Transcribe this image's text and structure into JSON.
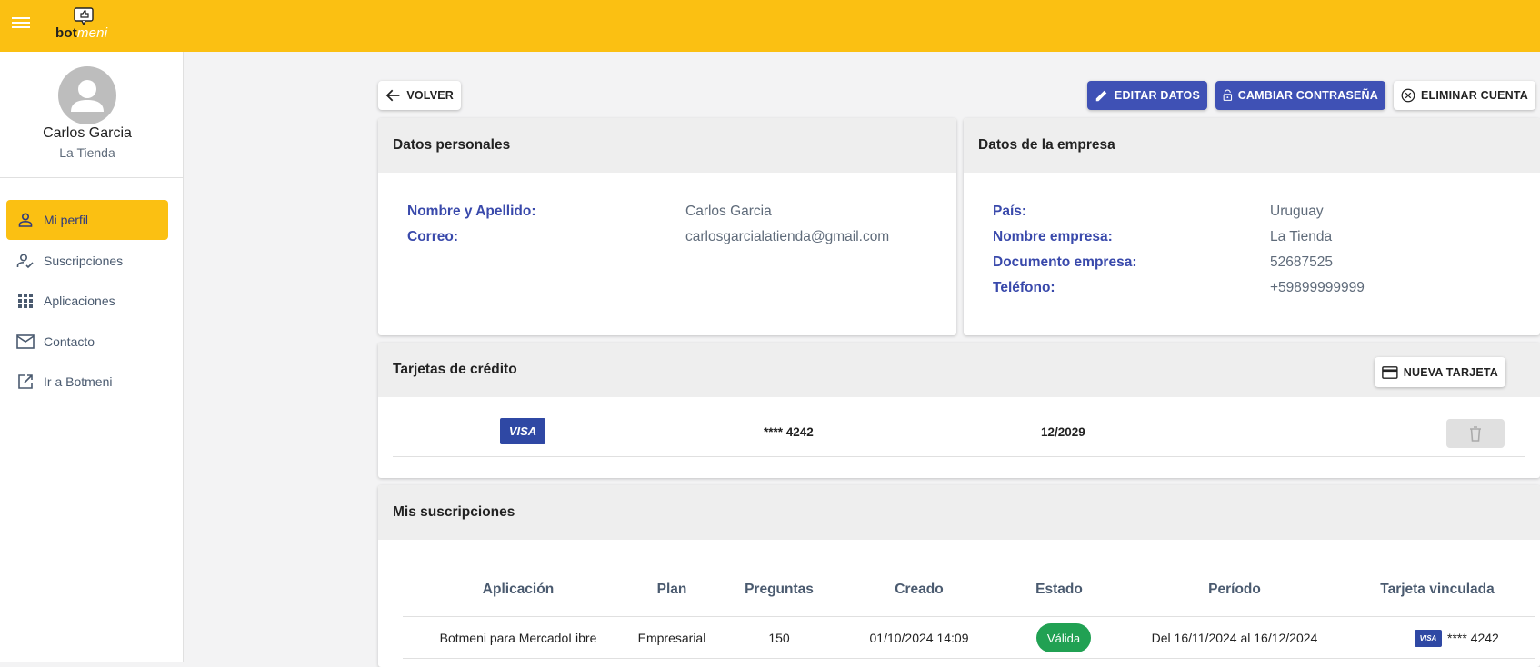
{
  "brand": {
    "word_bot": "bot",
    "word_meni": "meni"
  },
  "user": {
    "name": "Carlos Garcia",
    "company": "La Tienda"
  },
  "nav": {
    "items": [
      {
        "label": "Mi perfil",
        "icon": "person-icon",
        "active": true
      },
      {
        "label": "Suscripciones",
        "icon": "person-check-icon",
        "active": false
      },
      {
        "label": "Aplicaciones",
        "icon": "apps-grid-icon",
        "active": false
      },
      {
        "label": "Contacto",
        "icon": "mail-icon",
        "active": false
      },
      {
        "label": "Ir a Botmeni",
        "icon": "open-external-icon",
        "active": false
      }
    ]
  },
  "actions": {
    "back": "VOLVER",
    "edit": "EDITAR DATOS",
    "change_password": "CAMBIAR CONTRASEÑA",
    "delete_account": "ELIMINAR CUENTA"
  },
  "personal": {
    "title": "Datos personales",
    "fields": [
      {
        "key": "Nombre y Apellido:",
        "value": "Carlos Garcia"
      },
      {
        "key": "Correo:",
        "value": "carlosgarcialatienda@gmail.com"
      }
    ]
  },
  "company": {
    "title": "Datos de la empresa",
    "fields": [
      {
        "key": "País:",
        "value": "Uruguay"
      },
      {
        "key": "Nombre empresa:",
        "value": "La Tienda"
      },
      {
        "key": "Documento empresa:",
        "value": "52687525"
      },
      {
        "key": "Teléfono:",
        "value": "+59899999999"
      }
    ]
  },
  "cards": {
    "title": "Tarjetas de crédito",
    "new_card": "NUEVA TARJETA",
    "rows": [
      {
        "brand": "VISA",
        "number": "**** 4242",
        "expiry": "12/2029"
      }
    ]
  },
  "subscriptions": {
    "title": "Mis suscripciones",
    "headers": [
      "Aplicación",
      "Plan",
      "Preguntas",
      "Creado",
      "Estado",
      "Período",
      "Tarjeta vinculada"
    ],
    "rows": [
      {
        "app": "Botmeni para MercadoLibre",
        "plan": "Empresarial",
        "questions": "150",
        "created": "01/10/2024 14:09",
        "status": "Válida",
        "period": "Del 16/11/2024 al 16/12/2024",
        "card_brand": "VISA",
        "card_number": "**** 4242"
      }
    ]
  },
  "colors": {
    "brand_yellow": "#fbc012",
    "primary_blue": "#3f51b5",
    "status_green": "#21a153"
  }
}
